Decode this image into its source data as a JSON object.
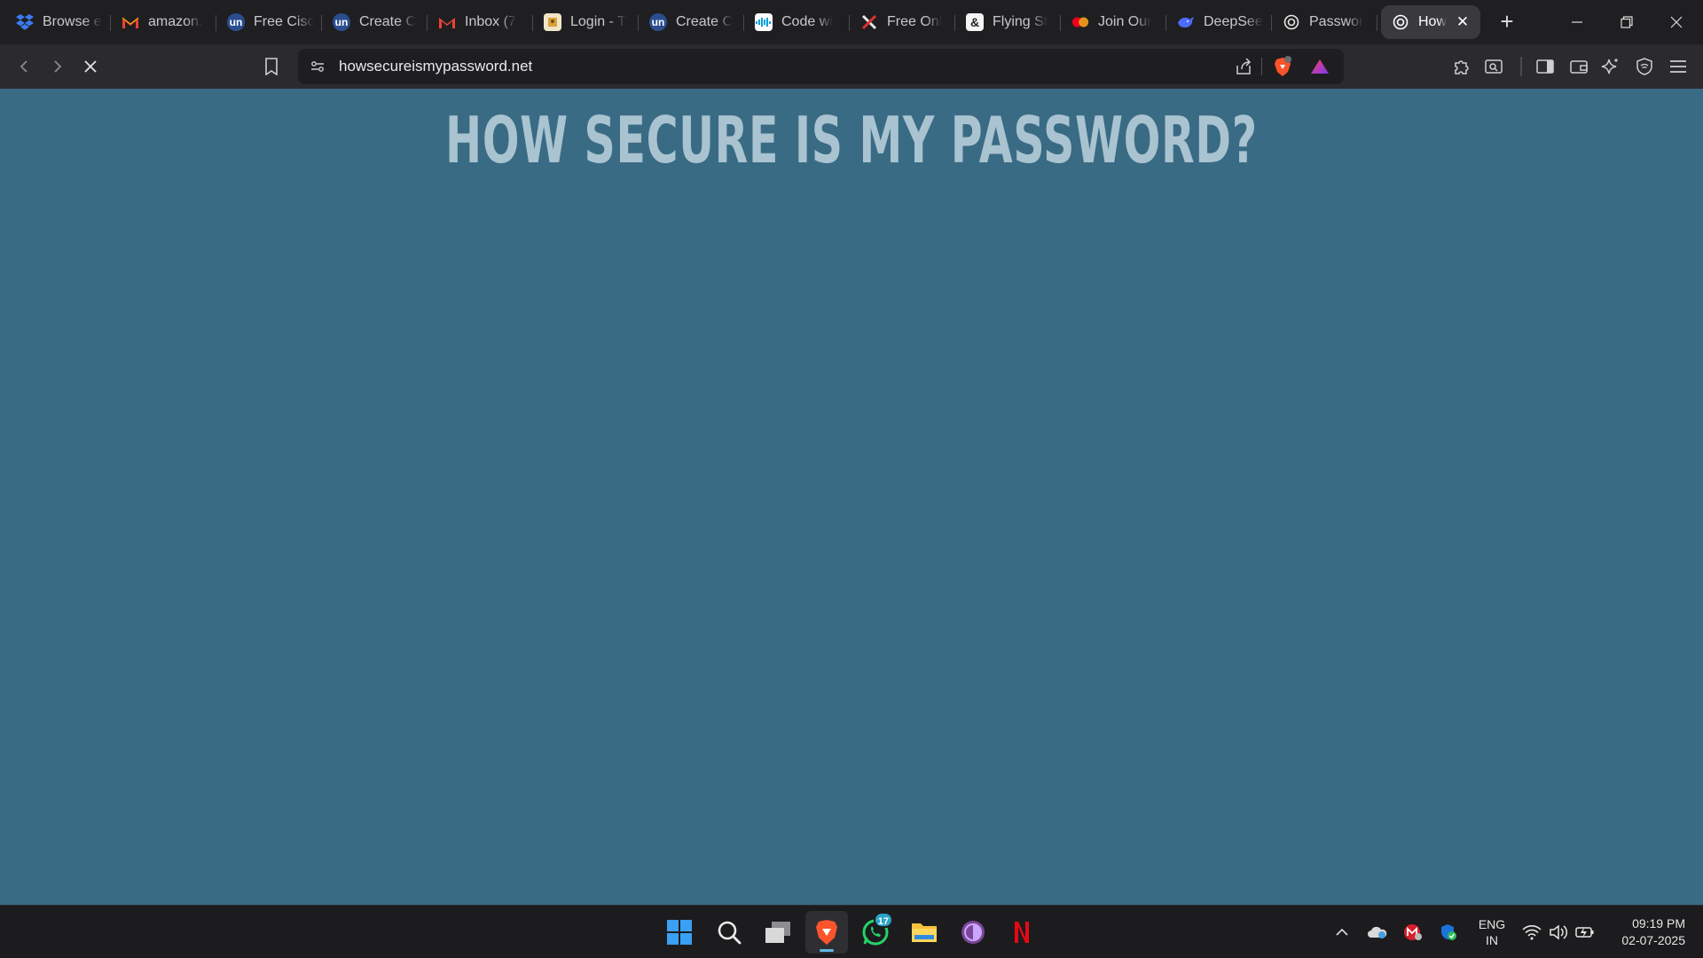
{
  "browser": {
    "tabs": [
      {
        "label": "Browse e",
        "icon": "dropbox-icon"
      },
      {
        "label": "amazon.",
        "icon": "gmail-icon"
      },
      {
        "label": "Free Cisc",
        "icon": "un-icon"
      },
      {
        "label": "Create C",
        "icon": "un-icon"
      },
      {
        "label": "Inbox (7",
        "icon": "gmail-icon"
      },
      {
        "label": "Login - T",
        "icon": "login-icon"
      },
      {
        "label": "Create C",
        "icon": "un-icon"
      },
      {
        "label": "Code wi",
        "icon": "cisco-icon"
      },
      {
        "label": "Free Onl",
        "icon": "x-icon"
      },
      {
        "label": "Flying St",
        "icon": "ampersand-icon"
      },
      {
        "label": "Join Our",
        "icon": "mastercard-icon"
      },
      {
        "label": "DeepSee",
        "icon": "deepseek-icon"
      },
      {
        "label": "Passwor",
        "icon": "openai-icon"
      }
    ],
    "active_tab": {
      "label": "How",
      "icon": "openai-icon"
    },
    "address": "howsecureismypassword.net"
  },
  "page": {
    "headline": "HOW SECURE IS MY PASSWORD?"
  },
  "taskbar": {
    "whatsapp_badge": "17",
    "lang_line1": "ENG",
    "lang_line2": "IN",
    "time": "09:19 PM",
    "date": "02-07-2025"
  },
  "colors": {
    "page_bg": "#3a6b84",
    "headline": "#a9c3d1",
    "tabstrip_bg": "#1f1f21",
    "toolbar_bg": "#2b2b2e",
    "taskbar_bg": "#1c1c1e"
  }
}
